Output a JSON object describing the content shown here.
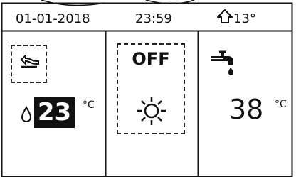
{
  "status_bar": {
    "date": "01-01-2018",
    "time": "23:59",
    "outdoor_temp": "13°"
  },
  "left_panel": {
    "mode_icon": "heat-pump-mode-icon",
    "setpoint": "23",
    "unit": "°C"
  },
  "center_panel": {
    "power_label": "OFF",
    "mode_icon": "sun-icon"
  },
  "right_panel": {
    "icon": "tap-icon",
    "temperature": "38",
    "unit": "°C"
  },
  "colors": {
    "background": "#ffffff",
    "foreground": "#111111",
    "highlight": "#111111",
    "highlight_text": "#ffffff"
  }
}
